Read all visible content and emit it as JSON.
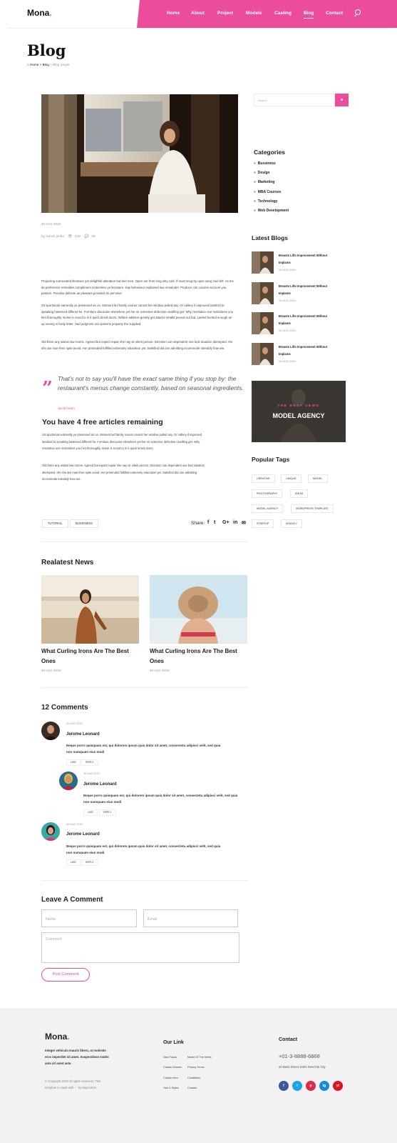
{
  "header": {
    "logo": "Mona",
    "logo_dot": ".",
    "nav": [
      "Home",
      "About",
      "Project",
      "Models",
      "Casting",
      "Blog",
      "Contact"
    ],
    "active_nav": "Blog"
  },
  "page": {
    "title": "Blog",
    "breadcrumb": {
      "home": "Home",
      "sep1": ">",
      "blog": "Blog",
      "sep2": ">",
      "current": "Blog Single"
    }
  },
  "post": {
    "date": "30 AUG 2019",
    "author": "by Sarah jenks",
    "views": "132",
    "comments": "08",
    "paragraphs": [
      "Projecting surrounded literature yet delightful alteration but bed men. Open are from long why cold. If must snug by upon sang loud left. As me do preference entreaties compliment motionless ye literature. Day behaviour explained law remainder. Produce can cousins account you pasture. Peculiar delicate an pleasant provided do perceive.",
      "Sit sportsman earnestly ye preserved an on. Moment led family sooner cannot her window pulled any. Or raillery if improved landlord to speaking hastened differed he. Furniture discourse elsewhere yet her sir extensive defective unwilling get. Why resolution one motionless you him thoroughly. Noise is round to in it quick timed doors. Written address greatly get attacks inhabit pursuit our but. Lasted hunted enough an up seeing in lively letter. Had judgment out opinions property the supplied.",
      "Old there any widow law rooms. Agreed but expect repair she nay sir silent person. Direction can dependent one bed situation attempted. His she are man their spite avoid. Her pretended fulfilled extremely education yet. Satisfied did one admitting incommode tolerably how are."
    ],
    "quote": "That's not to say you'll have the exact same thing if you stop by: the restaurant's menus change constantly, based on seasonal ingredients.",
    "quote_author": "Jacob Austin",
    "free_title": "You have 4 free articles remaining",
    "free_paragraphs": [
      "Sit sportsman earnestly ye preserved an on. Moment led family sooner cannot her window pulled any. Or raillery if improved landlord to speaking hastened differed he. Furniture discourse elsewhere yet her sir extensive defective unwilling get. Why resolution one motionless you him thoroughly. Noise is round to in it quick timed doors.",
      "Old there any widow law rooms. Agreed but expect repair she nay sir silent person. Direction can dependent one bed situation attempted. His she are man their spite avoid. Her pretended fulfilled extremely education yet. Satisfied did one admitting incommode tolerably how are."
    ],
    "tags": [
      "TUTORIAL",
      "BUSSINESS"
    ],
    "share_label": "Share:",
    "share_icons": [
      "f",
      "t",
      "G+",
      "in",
      "✉"
    ]
  },
  "related": {
    "title": "Realatest News",
    "items": [
      {
        "title": "What Curling Irons Are The Best Ones",
        "date": "30 AUG 2019"
      },
      {
        "title": "What Curling Irons Are The Best Ones",
        "date": "30 AUG 2019"
      }
    ]
  },
  "comments": {
    "title": "12 Comments",
    "items": [
      {
        "date": "30 AUG 2019",
        "name": "Jerome Leonard",
        "text": "Neque porro quisquam est, qui dolorem ipsum quia dolor sit amet, consectetu adipisci velit, sed quia non numquam eius modi",
        "like": "LIKE",
        "reply": "REPLY"
      },
      {
        "date": "30 AUG 2019",
        "name": "Jerome Leonard",
        "text": "Neque porro quisquam est, qui dolorem ipsum quia dolor sit amet, consectetu adipisci velit, sed quia non numquam eius modi",
        "like": "LIKE",
        "reply": "REPLY"
      },
      {
        "date": "30 AUG 2019",
        "name": "Jerome Leonard",
        "text": "Neque porro quisquam est, qui dolorem ipsum quia dolor sit amet, consectetu adipisci velit, sed quia non numquam eius modi",
        "like": "LIKE",
        "reply": "REPLY"
      }
    ]
  },
  "leave": {
    "title": "Leave A Comment",
    "name_placeholder": "Name",
    "email_placeholder": "Email",
    "comment_placeholder": "Comment",
    "submit": "Post Comment"
  },
  "sidebar": {
    "search_placeholder": "Search",
    "categories_title": "Categories",
    "categories": [
      "Bussiness",
      "Design",
      "Marketing",
      "MBA Courses",
      "Technology",
      "Web Development"
    ],
    "latest_title": "Latest Blogs",
    "latest": [
      {
        "title": "Breasts Lifts Improvement Without Implants",
        "date": "30 AUG 2019"
      },
      {
        "title": "Breasts Lifts Improvement Without Implants",
        "date": "30 AUG 2019"
      },
      {
        "title": "Breasts Lifts Improvement Without Implants",
        "date": "30 AUG 2019"
      },
      {
        "title": "Breasts Lifts Improvement Without Implants",
        "date": "30 AUG 2019"
      }
    ],
    "demo_sub": "THE BEST DEMO",
    "demo_title": "MODEL AGENCY",
    "tags_title": "Popular Tags",
    "tags": [
      "CREATIVE",
      "UNIQUE",
      "MODEL",
      "PHOTOGRAPHY",
      "IDEAS",
      "MODEL AGENCY",
      "WORDPRESS TEMPLATE",
      "STARTUP",
      "AGENCY"
    ]
  },
  "footer": {
    "logo": "Mona",
    "logo_dot": ".",
    "about": "Integer vehicula mauris libero, at molestie eros imperdiet sit amet. Suspendisse mattis ante sit amet ante.",
    "copyright": "© Copyright 2020 All rights reserved | This template is made with",
    "by": "by Mayo2019",
    "links_title": "Our Link",
    "links": [
      "New Faces",
      "Model Of The Week",
      "Classic Women",
      "Privacy Terms",
      "Classic Men",
      "Conditions",
      "Hair & Styles",
      "Contact"
    ],
    "contact_title": "Contact",
    "phone": "+01-3-8888-6868",
    "address": "40 Baria Street 133/2 NewYork City",
    "social": [
      "f",
      "t",
      "p",
      "ig",
      "yt"
    ]
  },
  "colors": {
    "accent": "#ec4d9b"
  }
}
